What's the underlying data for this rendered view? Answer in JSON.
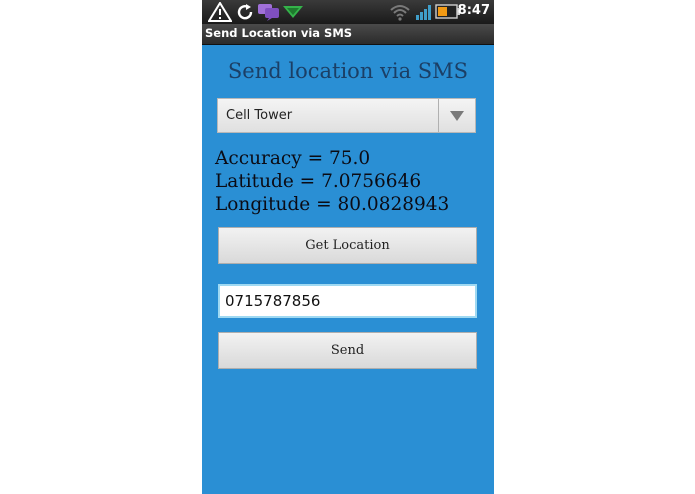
{
  "status_bar": {
    "time": "8:47",
    "icons": [
      "warning-icon",
      "sync-icon",
      "chat-icon",
      "notification-icon",
      "wifi-icon",
      "signal-icon",
      "battery-icon"
    ]
  },
  "app": {
    "title": "Send Location via SMS"
  },
  "main": {
    "heading": "Send location via SMS",
    "provider_select": {
      "selected": "Cell Tower"
    },
    "accuracy_text": "Accuracy = 75.0",
    "latitude_text": "Latitude = 7.0756646",
    "longitude_text": "Longitude = 80.0828943",
    "get_location_label": "Get Location",
    "phone_number": "0715787856",
    "send_label": "Send"
  },
  "colors": {
    "background": "#2a8fd4",
    "heading": "#1b3f66",
    "input_focus": "#9fd9f2"
  }
}
